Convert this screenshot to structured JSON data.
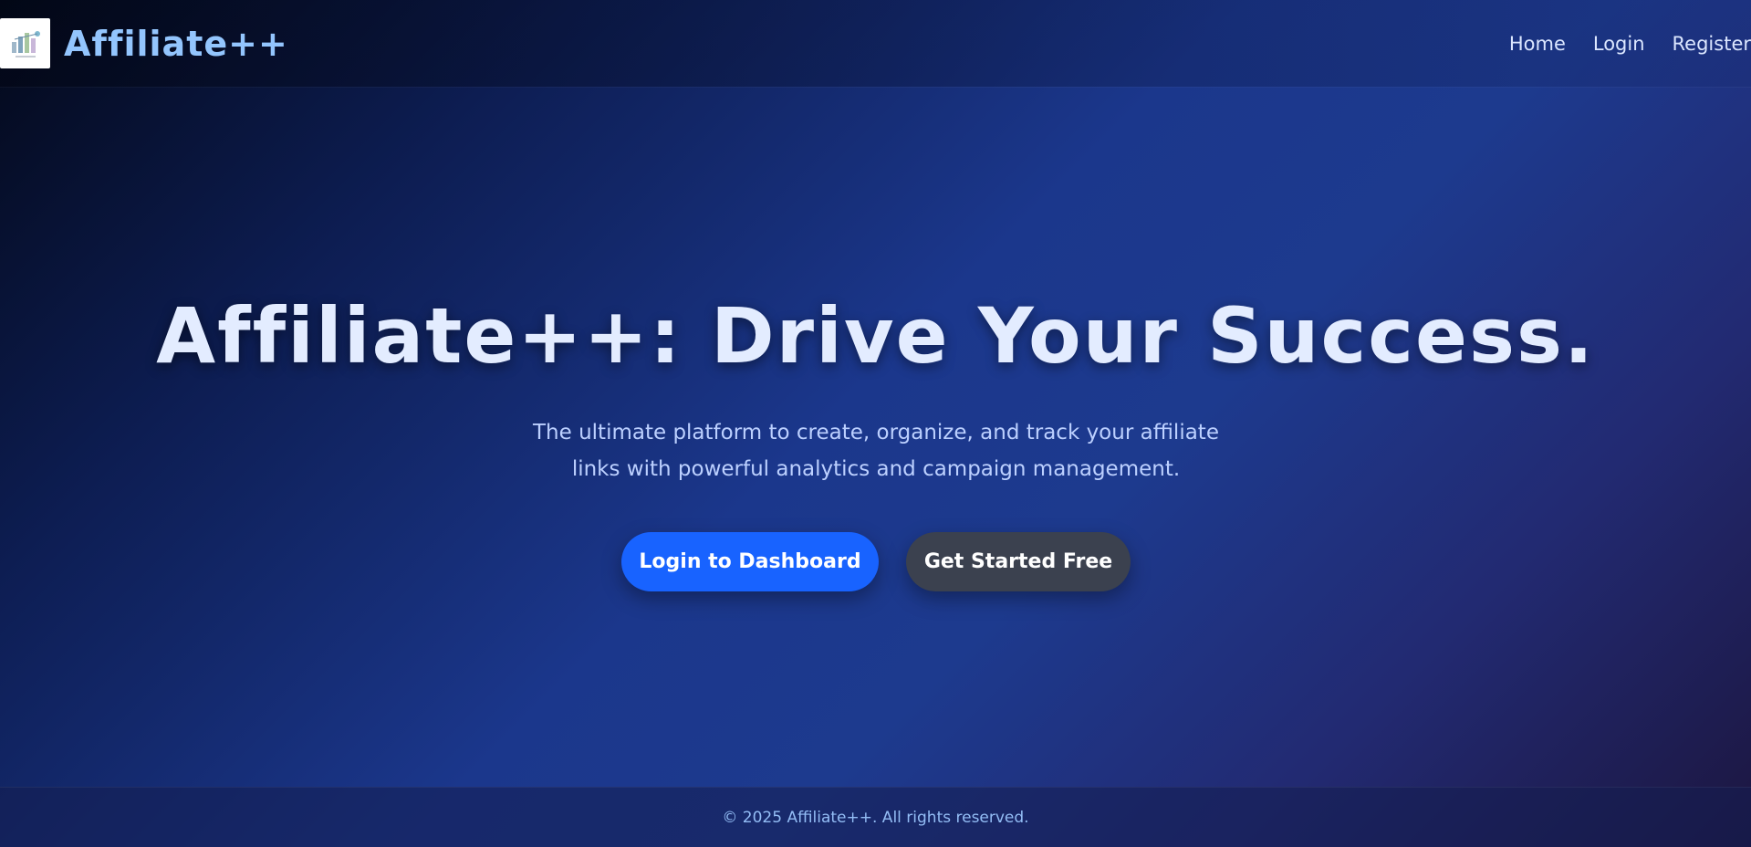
{
  "brand": {
    "name": "Affiliate++",
    "logo_icon": "logo-icon"
  },
  "nav": {
    "items": [
      {
        "label": "Home"
      },
      {
        "label": "Login"
      },
      {
        "label": "Register"
      }
    ]
  },
  "hero": {
    "title": "Affiliate++: Drive Your Success.",
    "subtitle": "The ultimate platform to create, organize, and track your affiliate links with powerful analytics and campaign management.",
    "primary_button": "Login to Dashboard",
    "secondary_button": "Get Started Free"
  },
  "footer": {
    "copyright": "© 2025 Affiliate++. All rights reserved."
  },
  "colors": {
    "primary_button": "#1863ff",
    "secondary_button": "#3b414f",
    "brand_text": "#93c5fd",
    "title_text": "#e3ecff"
  }
}
